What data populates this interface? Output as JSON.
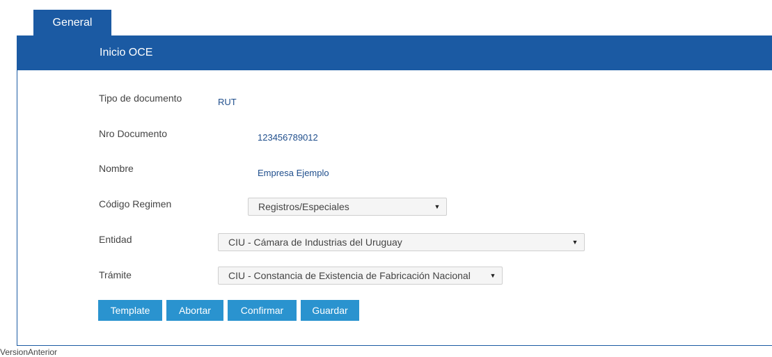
{
  "tabs": [
    {
      "label": "General"
    }
  ],
  "panel": {
    "title": "Inicio OCE"
  },
  "form": {
    "tipo_documento": {
      "label": "Tipo de documento",
      "value": "RUT"
    },
    "nro_documento": {
      "label": "Nro Documento",
      "value": "123456789012"
    },
    "nombre": {
      "label": "Nombre",
      "value": "Empresa Ejemplo"
    },
    "codigo_regimen": {
      "label": "Código Regimen",
      "selected": "Registros/Especiales"
    },
    "entidad": {
      "label": "Entidad",
      "selected": "CIU - Cámara de Industrias del Uruguay"
    },
    "tramite": {
      "label": "Trámite",
      "selected": "CIU - Constancia de Existencia de Fabricación Nacional"
    }
  },
  "buttons": {
    "template": "Template",
    "abortar": "Abortar",
    "confirmar": "Confirmar",
    "guardar": "Guardar"
  },
  "footer": {
    "text": "VersionAnterior"
  },
  "icons": {
    "dropdown": "triangle-down-icon"
  },
  "colors": {
    "header": "#1b5aa3",
    "button": "#2a93cf",
    "value_text": "#1f4e8c"
  }
}
